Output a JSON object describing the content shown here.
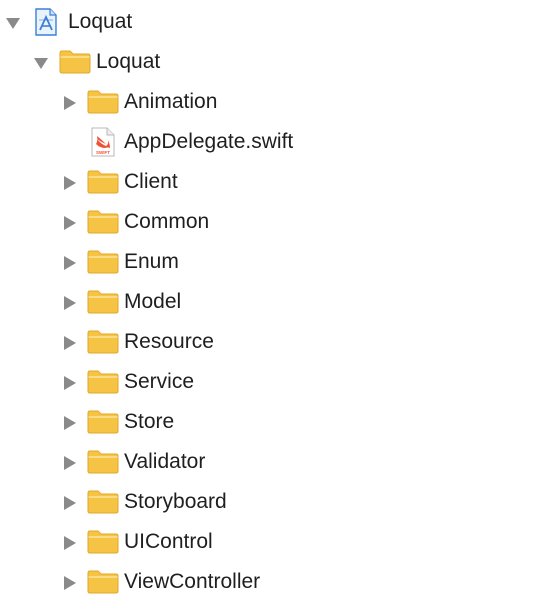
{
  "navigator": {
    "project": {
      "name": "Loquat",
      "expanded": true,
      "icon": "xcode-project-icon"
    },
    "group": {
      "name": "Loquat",
      "expanded": true,
      "icon": "folder-icon"
    },
    "items": [
      {
        "name": "Animation",
        "kind": "folder",
        "expanded": false
      },
      {
        "name": "AppDelegate.swift",
        "kind": "swift-file"
      },
      {
        "name": "Client",
        "kind": "folder",
        "expanded": false
      },
      {
        "name": "Common",
        "kind": "folder",
        "expanded": false
      },
      {
        "name": "Enum",
        "kind": "folder",
        "expanded": false
      },
      {
        "name": "Model",
        "kind": "folder",
        "expanded": false
      },
      {
        "name": "Resource",
        "kind": "folder",
        "expanded": false
      },
      {
        "name": "Service",
        "kind": "folder",
        "expanded": false
      },
      {
        "name": "Store",
        "kind": "folder",
        "expanded": false
      },
      {
        "name": "Validator",
        "kind": "folder",
        "expanded": false
      },
      {
        "name": "Storyboard",
        "kind": "folder",
        "expanded": false
      },
      {
        "name": "UIControl",
        "kind": "folder",
        "expanded": false
      },
      {
        "name": "ViewController",
        "kind": "folder",
        "expanded": false
      }
    ],
    "swift_badge_text": "SWIFT",
    "colors": {
      "folder_body": "#F5C445",
      "folder_edge": "#E0A82A",
      "folder_highlight": "#FCE39A",
      "disclosure": "#8a8a8a",
      "text": "#1f1f1f",
      "swift_orange": "#F05138",
      "project_blue": "#3B7FD9"
    }
  }
}
